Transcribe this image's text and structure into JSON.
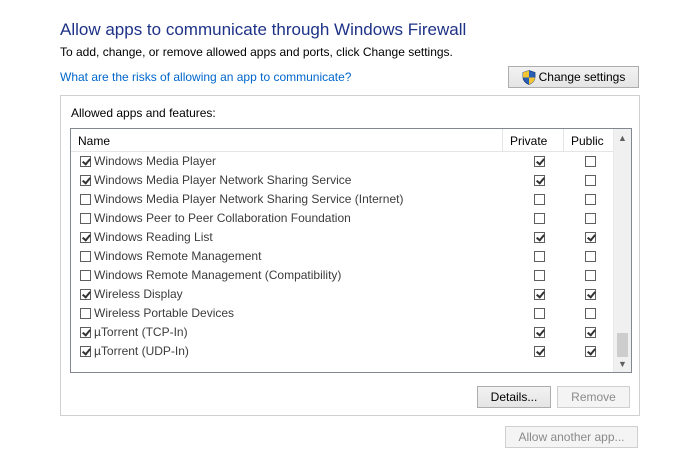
{
  "page": {
    "title": "Allow apps to communicate through Windows Firewall",
    "subtitle": "To add, change, or remove allowed apps and ports, click Change settings.",
    "risk_link": "What are the risks of allowing an app to communicate?",
    "change_settings_label": "Change settings"
  },
  "group": {
    "label": "Allowed apps and features:",
    "columns": {
      "name": "Name",
      "private": "Private",
      "public": "Public"
    },
    "rows": [
      {
        "name": "Windows Media Player",
        "enabled": true,
        "private": true,
        "public": false
      },
      {
        "name": "Windows Media Player Network Sharing Service",
        "enabled": true,
        "private": true,
        "public": false
      },
      {
        "name": "Windows Media Player Network Sharing Service (Internet)",
        "enabled": false,
        "private": false,
        "public": false
      },
      {
        "name": "Windows Peer to Peer Collaboration Foundation",
        "enabled": false,
        "private": false,
        "public": false
      },
      {
        "name": "Windows Reading List",
        "enabled": true,
        "private": true,
        "public": true
      },
      {
        "name": "Windows Remote Management",
        "enabled": false,
        "private": false,
        "public": false
      },
      {
        "name": "Windows Remote Management (Compatibility)",
        "enabled": false,
        "private": false,
        "public": false
      },
      {
        "name": "Wireless Display",
        "enabled": true,
        "private": true,
        "public": true
      },
      {
        "name": "Wireless Portable Devices",
        "enabled": false,
        "private": false,
        "public": false
      },
      {
        "name": "µTorrent (TCP-In)",
        "enabled": true,
        "private": true,
        "public": true
      },
      {
        "name": "µTorrent (UDP-In)",
        "enabled": true,
        "private": true,
        "public": true
      }
    ],
    "details_label": "Details...",
    "remove_label": "Remove"
  },
  "footer": {
    "allow_another_label": "Allow another app..."
  },
  "icons": {
    "shield": "uac-shield-icon",
    "scroll_up": "scroll-up-arrow-icon",
    "scroll_down": "scroll-down-arrow-icon"
  },
  "colors": {
    "title": "#1e3287",
    "link": "#0066cc"
  }
}
